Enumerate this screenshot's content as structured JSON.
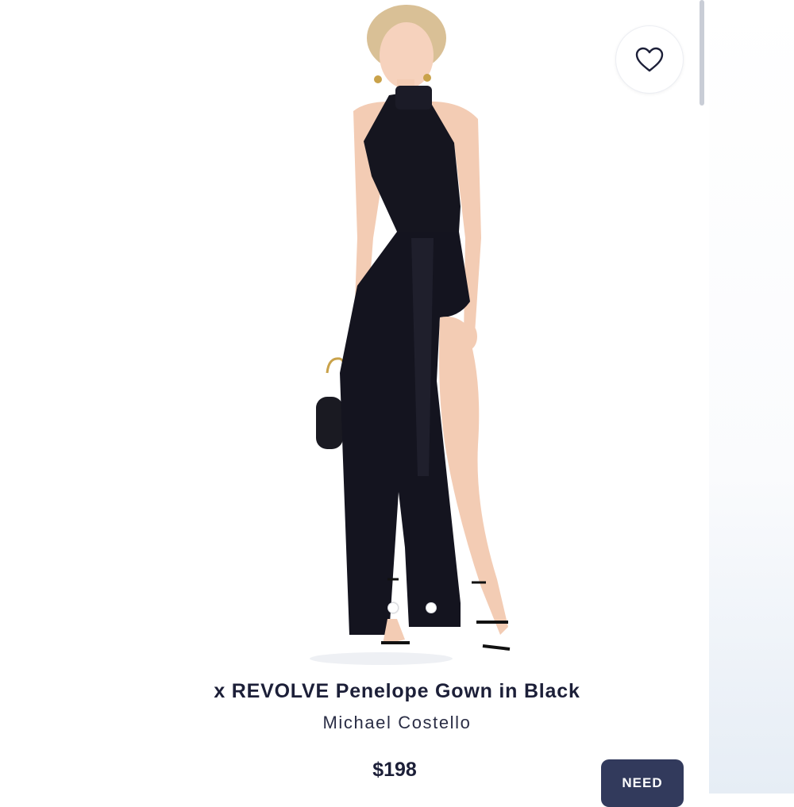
{
  "product": {
    "title": "x REVOLVE Penelope Gown in Black",
    "brand": "Michael Costello",
    "price": "$198"
  },
  "actions": {
    "favorite_icon": "heart-outline-icon",
    "need_label": "NEED"
  },
  "carousel": {
    "count": 2,
    "active_index": 0
  },
  "colors": {
    "title_text": "#1c1f38",
    "button_bg": "#323a5c",
    "dress": "#14141f"
  }
}
